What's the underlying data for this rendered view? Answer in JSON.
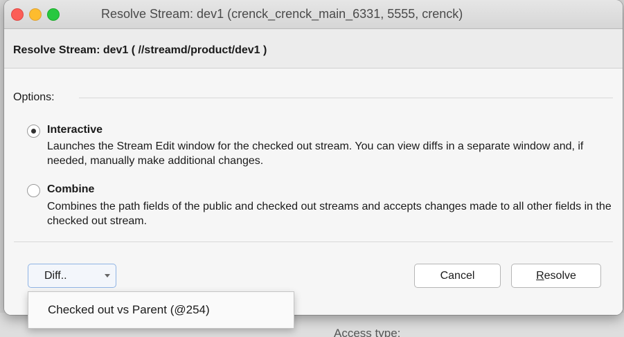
{
  "window": {
    "title": "Resolve Stream: dev1 (crenck_crenck_main_6331,  5555,  crenck)"
  },
  "dialog": {
    "heading": "Resolve Stream: dev1 ( //streamd/product/dev1 )",
    "options_label": "Options:",
    "options": [
      {
        "title": "Interactive",
        "checked": true,
        "description": "Launches the Stream Edit window for the checked out stream. You can view diffs in a separate window and, if needed, manually make additional changes."
      },
      {
        "title": "Combine",
        "checked": false,
        "description": "Combines the path fields of the public and checked out streams and accepts changes made to all other fields in the checked out stream."
      }
    ],
    "buttons": {
      "diff": "Diff..",
      "cancel": "Cancel",
      "resolve_first": "R",
      "resolve_rest": "esolve"
    },
    "diff_menu": {
      "items": [
        "Checked out vs Parent (@254)"
      ]
    }
  },
  "background": {
    "label": "Access type:"
  }
}
